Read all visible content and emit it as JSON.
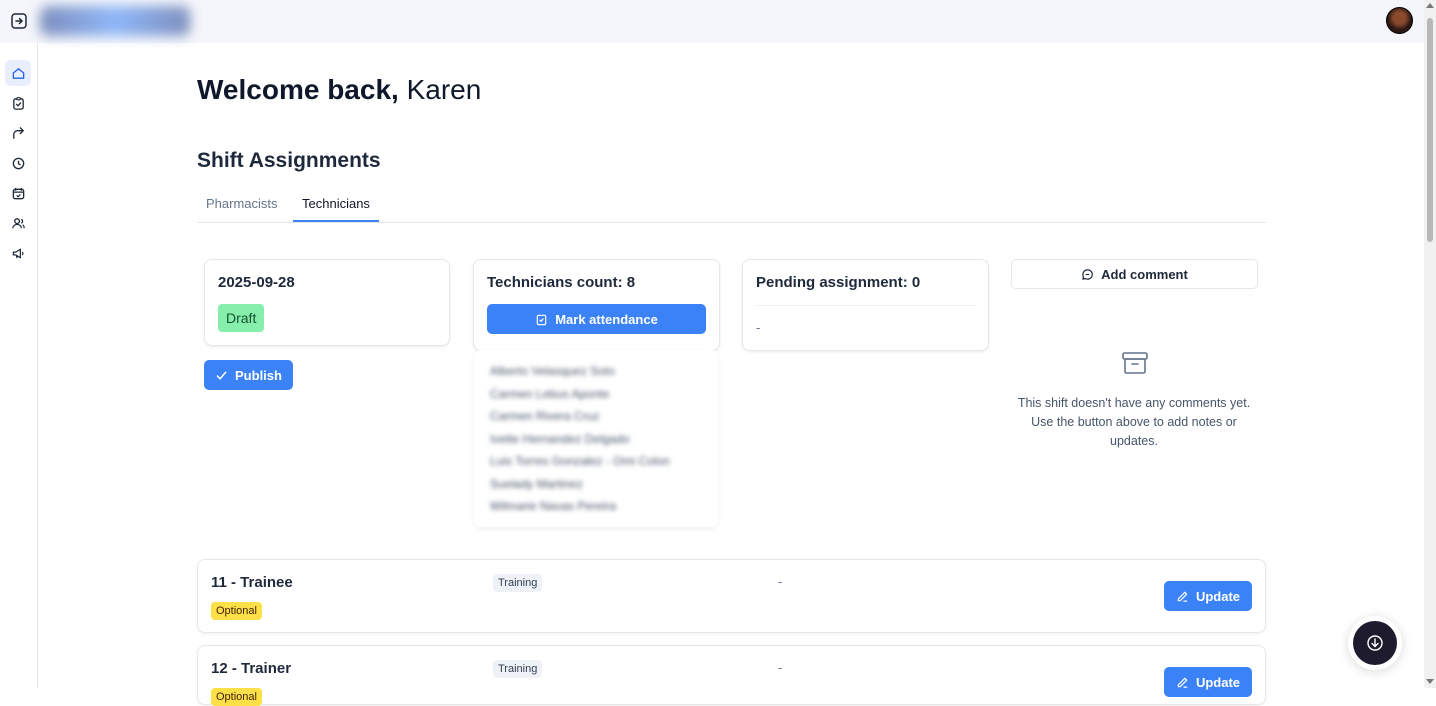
{
  "header": {
    "collapse_icon": "sidebar-toggle-icon",
    "logo_label": "Roster",
    "avatar_icon": "user-avatar"
  },
  "sidebar": {
    "items": [
      {
        "icon": "home-icon",
        "active": true
      },
      {
        "icon": "clipboard-check-icon",
        "active": false
      },
      {
        "icon": "forward-arrow-icon",
        "active": false
      },
      {
        "icon": "clock-history-icon",
        "active": false
      },
      {
        "icon": "calendar-check-icon",
        "active": false
      },
      {
        "icon": "users-icon",
        "active": false
      },
      {
        "icon": "megaphone-icon",
        "active": false
      }
    ]
  },
  "welcome": {
    "prefix": "Welcome back,",
    "name": "Karen"
  },
  "section_title": "Shift Assignments",
  "tabs": [
    {
      "label": "Pharmacists",
      "active": false
    },
    {
      "label": "Technicians",
      "active": true
    }
  ],
  "date_card": {
    "date": "2025-09-28",
    "status": "Draft"
  },
  "publish_label": "Publish",
  "tech_card": {
    "title": "Technicians count: 8",
    "mark_label": "Mark attendance",
    "names": [
      "Alberto Velasquez Soto",
      "Carmen Lebus Aponte",
      "Carmen Rivera Cruz",
      "Ivette Hernandez Delgado",
      "Luis Torres Gonzalez - Omi Colon",
      "Suelady Martinez",
      "Wilmarie Navas Pereira"
    ]
  },
  "pending_card": {
    "title": "Pending assignment: 0",
    "value": "-"
  },
  "comments": {
    "add_label": "Add comment",
    "empty_line1": "This shift doesn't have any comments yet.",
    "empty_line2": "Use the button above to add notes or",
    "empty_line3": "updates."
  },
  "rows": [
    {
      "title": "11 - Trainee",
      "badge": "Optional",
      "type": "Training",
      "note": "-",
      "action": "Update"
    },
    {
      "title": "12 - Trainer",
      "badge": "Optional",
      "type": "Training",
      "note": "-",
      "action": "Update"
    }
  ],
  "colors": {
    "accent": "#3b82f6",
    "draft": "#86efac",
    "optional": "#fde047"
  }
}
